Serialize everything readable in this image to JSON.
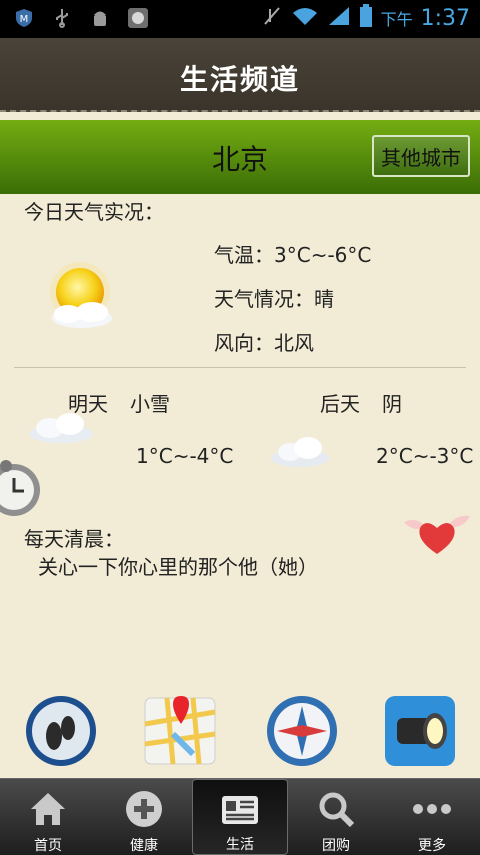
{
  "status_bar": {
    "time": "1:37",
    "ampm": "下午"
  },
  "header": {
    "title": "生活频道"
  },
  "city": {
    "name": "北京",
    "other_button": "其他城市"
  },
  "today": {
    "heading": "今日天气实况：",
    "temperature": "气温：3°C~-6°C",
    "condition": "天气情况：晴",
    "wind": "风向：北风"
  },
  "forecast": [
    {
      "day": "明天",
      "condition": "小雪",
      "temp": "1°C~-4°C"
    },
    {
      "day": "后天",
      "condition": "阴",
      "temp": "2°C~-3°C"
    }
  ],
  "morning": {
    "heading": "每天清晨：",
    "message": "关心一下你心里的那个他（她）"
  },
  "tabs": [
    {
      "label": "首页",
      "icon": "home-icon"
    },
    {
      "label": "健康",
      "icon": "plus-icon"
    },
    {
      "label": "生活",
      "icon": "news-icon"
    },
    {
      "label": "团购",
      "icon": "search-icon"
    },
    {
      "label": "更多",
      "icon": "more-icon"
    }
  ],
  "active_tab": "生活",
  "colors": {
    "header": "#3f382f",
    "city_bar": "#5a8d0d",
    "accent": "#4aa3df"
  }
}
